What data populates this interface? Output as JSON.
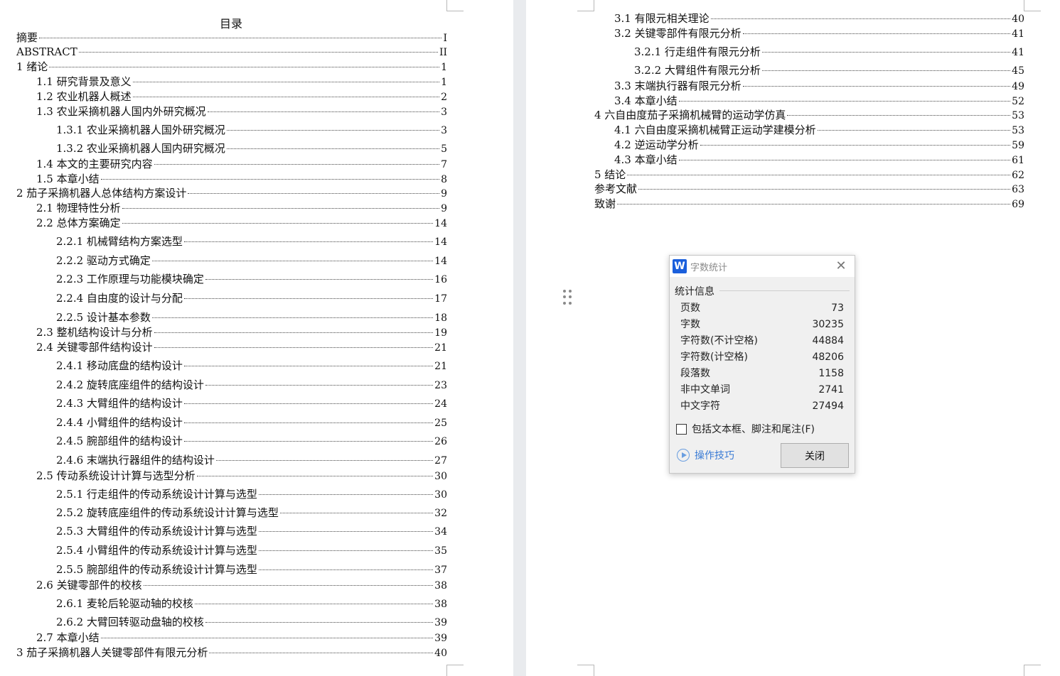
{
  "toc": {
    "title": "目录",
    "left": [
      {
        "text": "摘要",
        "page": "I"
      },
      {
        "text": "ABSTRACT",
        "page": "II"
      },
      {
        "text": "1 绪论",
        "page": "1"
      },
      {
        "text": "1.1  研究背景及意义",
        "page": "1"
      },
      {
        "text": "1.2  农业机器人概述",
        "page": "2"
      },
      {
        "text": "1.3  农业采摘机器人国内外研究概况",
        "page": "3"
      },
      {
        "text": "1.3.1  农业采摘机器人国外研究概况",
        "page": "3"
      },
      {
        "text": "1.3.2  农业采摘机器人国内研究概况",
        "page": "5"
      },
      {
        "text": "1.4  本文的主要研究内容",
        "page": "7"
      },
      {
        "text": "1.5  本章小结",
        "page": "8"
      },
      {
        "text": "2 茄子采摘机器人总体结构方案设计",
        "page": "9"
      },
      {
        "text": "2.1  物理特性分析",
        "page": "9"
      },
      {
        "text": "2.2  总体方案确定",
        "page": "14"
      },
      {
        "text": "2.2.1  机械臂结构方案选型",
        "page": "14"
      },
      {
        "text": "2.2.2  驱动方式确定",
        "page": "14"
      },
      {
        "text": "2.2.3  工作原理与功能模块确定",
        "page": "16"
      },
      {
        "text": "2.2.4  自由度的设计与分配",
        "page": "17"
      },
      {
        "text": "2.2.5  设计基本参数",
        "page": "18"
      },
      {
        "text": "2.3  整机结构设计与分析",
        "page": "19"
      },
      {
        "text": "2.4  关键零部件结构设计",
        "page": "21"
      },
      {
        "text": "2.4.1  移动底盘的结构设计",
        "page": "21"
      },
      {
        "text": "2.4.2  旋转底座组件的结构设计",
        "page": "23"
      },
      {
        "text": "2.4.3  大臂组件的结构设计",
        "page": "24"
      },
      {
        "text": "2.4.4  小臂组件的结构设计",
        "page": "25"
      },
      {
        "text": "2.4.5  腕部组件的结构设计",
        "page": "26"
      },
      {
        "text": "2.4.6  末端执行器组件的结构设计",
        "page": "27"
      },
      {
        "text": "2.5  传动系统设计计算与选型分析",
        "page": "30"
      },
      {
        "text": "2.5.1  行走组件的传动系统设计计算与选型",
        "page": "30"
      },
      {
        "text": "2.5.2  旋转底座组件的传动系统设计计算与选型",
        "page": "32"
      },
      {
        "text": "2.5.3  大臂组件的传动系统设计计算与选型",
        "page": "34"
      },
      {
        "text": "2.5.4  小臂组件的传动系统设计计算与选型",
        "page": "35"
      },
      {
        "text": "2.5.5  腕部组件的传动系统设计计算与选型",
        "page": "37"
      },
      {
        "text": "2.6  关键零部件的校核",
        "page": "38"
      },
      {
        "text": "2.6.1  麦轮后轮驱动轴的校核",
        "page": "38"
      },
      {
        "text": "2.6.2  大臂回转驱动盘轴的校核",
        "page": "39"
      },
      {
        "text": "2.7  本章小结",
        "page": "39"
      },
      {
        "text": "3 茄子采摘机器人关键零部件有限元分析",
        "page": "40"
      }
    ],
    "right": [
      {
        "text": "3.1  有限元相关理论",
        "page": "40"
      },
      {
        "text": "3.2  关键零部件有限元分析",
        "page": "41"
      },
      {
        "text": "3.2.1  行走组件有限元分析",
        "page": "41"
      },
      {
        "text": "3.2.2  大臂组件有限元分析",
        "page": "45"
      },
      {
        "text": "3.3  末端执行器有限元分析",
        "page": "49"
      },
      {
        "text": "3.4  本章小结",
        "page": "52"
      },
      {
        "text": "4  六自由度茄子采摘机械臂的运动学仿真",
        "page": "53"
      },
      {
        "text": "4.1 六自由度采摘机械臂正运动学建模分析",
        "page": "53"
      },
      {
        "text": "4.2  逆运动学分析",
        "page": "59"
      },
      {
        "text": "4.3  本章小结",
        "page": "61"
      },
      {
        "text": "5  结论",
        "page": "62"
      },
      {
        "text": "参考文献",
        "page": "63"
      },
      {
        "text": "致谢",
        "page": "69"
      }
    ]
  },
  "dialog": {
    "logo": "W",
    "title": "字数统计",
    "close_glyph": "✕",
    "section": "统计信息",
    "stats": [
      {
        "label": "页数",
        "value": "73"
      },
      {
        "label": "字数",
        "value": "30235"
      },
      {
        "label": "字符数(不计空格)",
        "value": "44884"
      },
      {
        "label": "字符数(计空格)",
        "value": "48206"
      },
      {
        "label": "段落数",
        "value": "1158"
      },
      {
        "label": "非中文单词",
        "value": "2741"
      },
      {
        "label": "中文字符",
        "value": "27494"
      }
    ],
    "checkbox_label": "包括文本框、脚注和尾注(F)",
    "checkbox_checked": false,
    "tips_label": "操作技巧",
    "close_button": "关闭"
  }
}
